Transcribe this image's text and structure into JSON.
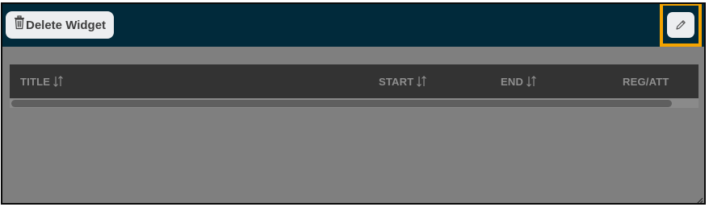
{
  "toolbar": {
    "delete_label": "Delete Widget",
    "delete_icon": "trash-icon",
    "edit_icon": "pencil-icon",
    "highlight_color": "#f4a400",
    "bar_color": "#012a3b"
  },
  "table": {
    "columns": [
      {
        "label": "TITLE",
        "sortable": true
      },
      {
        "label": "START",
        "sortable": true
      },
      {
        "label": "END",
        "sortable": true
      },
      {
        "label": "REG/ATT",
        "sortable": false
      }
    ],
    "sort_icon": "sort-arrows-icon",
    "rows": []
  }
}
